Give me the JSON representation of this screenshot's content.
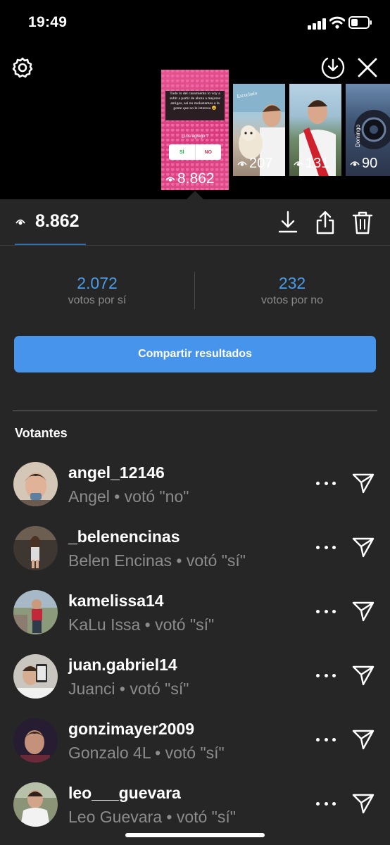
{
  "status_bar": {
    "time": "19:49"
  },
  "story": {
    "text": "Todo lo del casamiento lo voy a subir a partir de ahora a mejores amigos, así no molestamos a la gente que no le interesa 😄",
    "question": "¿Los agrego ?",
    "option_yes": "SÍ",
    "option_no": "NO",
    "views": "8.862",
    "other_thumbs": [
      {
        "views": "207",
        "sticker": "Escuchalo"
      },
      {
        "views": "131"
      },
      {
        "views": "90",
        "sticker": "Domingo"
      }
    ]
  },
  "stats": {
    "views": "8.862"
  },
  "poll": {
    "yes_count": "2.072",
    "yes_label": "votos por sí",
    "no_count": "232",
    "no_label": "votos por no"
  },
  "share_label": "Compartir resultados",
  "voters_title": "Votantes",
  "voters": [
    {
      "username": "angel_12146",
      "detail": "Angel • votó \"no\""
    },
    {
      "username": "_belenencinas",
      "detail": "Belen Encinas • votó \"sí\""
    },
    {
      "username": "kamelissa14",
      "detail": "KaLu Issa • votó \"sí\""
    },
    {
      "username": "juan.gabriel14",
      "detail": "Juanci • votó \"sí\""
    },
    {
      "username": "gonzimayer2009",
      "detail": "Gonzalo 4L • votó \"sí\""
    },
    {
      "username": "leo___guevara",
      "detail": "Leo Guevara • votó \"sí\""
    }
  ],
  "icons": [
    "settings-icon",
    "download-circle-icon",
    "close-icon",
    "eye-icon",
    "download-icon",
    "share-icon",
    "trash-icon",
    "more-icon",
    "send-icon"
  ],
  "colors": {
    "accent": "#4694ec",
    "vote_number": "#4a9be8",
    "background": "#262626"
  }
}
